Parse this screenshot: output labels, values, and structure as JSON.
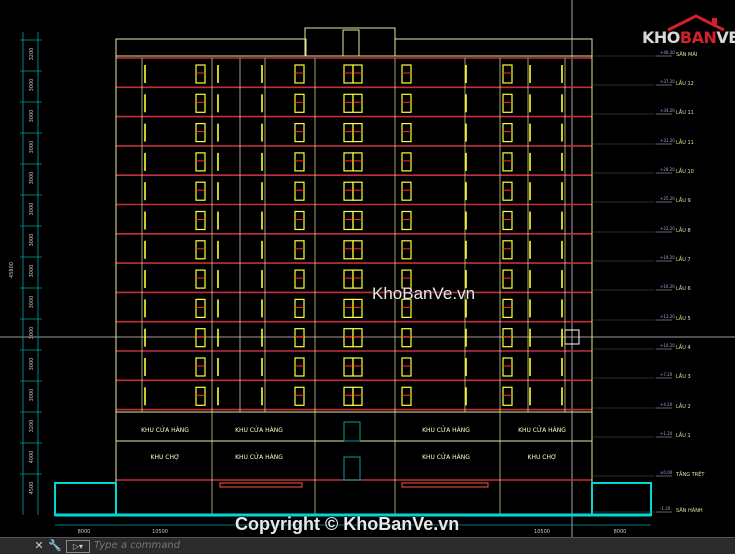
{
  "drawing": {
    "floor_labels": [
      "SÂN MÁI",
      "LẦU 12",
      "LẦU 11",
      "LẦU 11",
      "LẦU 10",
      "LẦU 9",
      "LẦU 8",
      "LẦU 7",
      "LẦU 6",
      "LẦU 5",
      "LẦU 4",
      "LẦU 3",
      "LẦU 2",
      "LẦU 1",
      "TẦNG TRỆT",
      "SÂN HÀNH"
    ],
    "level_marks": [
      "+40.20",
      "+37.20",
      "+34.20",
      "+31.20",
      "+28.20",
      "+25.20",
      "+22.20",
      "+19.20",
      "+16.20",
      "+13.20",
      "+10.20",
      "+7.20",
      "+4.20",
      "+1.20",
      "±0.00",
      "-1.20"
    ],
    "dim_left": [
      "3200",
      "3000",
      "3000",
      "3000",
      "3000",
      "3000",
      "3000",
      "3000",
      "3000",
      "3000",
      "3000",
      "3000",
      "3200",
      "4000",
      "4500"
    ],
    "total_height": "45800",
    "dim_bottom": [
      "8000",
      "10500",
      "",
      "10500",
      "8000"
    ],
    "shop_labels_upper": [
      "KHU CỬA HÀNG",
      "KHU CỬA HÀNG",
      "KHU CỬA HÀNG",
      "KHU CỬA HÀNG"
    ],
    "shop_labels_lower": [
      "KHU CHỢ",
      "KHU CỬA HÀNG",
      "KHU CỬA HÀNG",
      "KHU CHỢ"
    ]
  },
  "logo": {
    "kho": "KHO",
    "ban": "BAN",
    "ve": "VE"
  },
  "watermark": "KhoBanVe.vn",
  "copyright": "Copyright © KhoBanVe.vn",
  "command": {
    "placeholder": "Type a command",
    "close_glyph": "✕",
    "settings_glyph": "🔧"
  },
  "colors": {
    "background": "#000000",
    "wall": "#e6e6a0",
    "floor": "#c0303a",
    "window": "#ffff33",
    "grid": "#00a0a0",
    "foundation": "#00d8d8"
  }
}
